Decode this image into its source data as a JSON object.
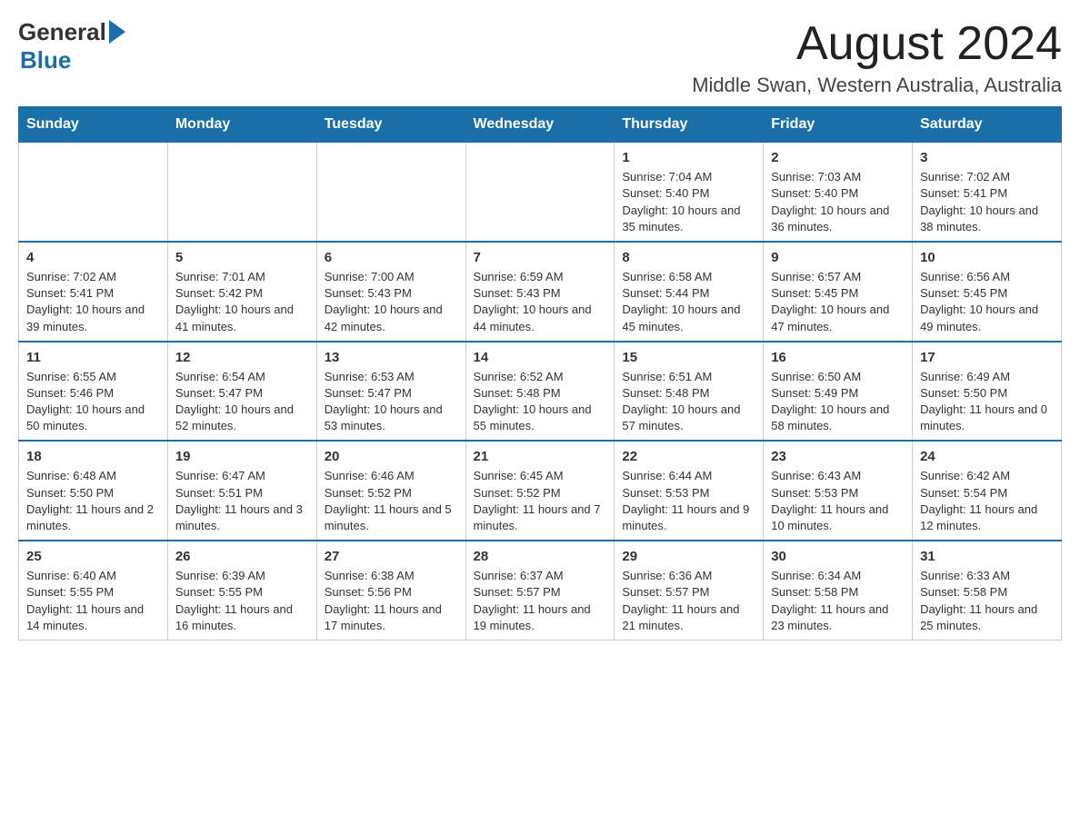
{
  "logo": {
    "general": "General",
    "blue": "Blue"
  },
  "header": {
    "title": "August 2024",
    "subtitle": "Middle Swan, Western Australia, Australia"
  },
  "days": {
    "headers": [
      "Sunday",
      "Monday",
      "Tuesday",
      "Wednesday",
      "Thursday",
      "Friday",
      "Saturday"
    ]
  },
  "weeks": [
    {
      "cells": [
        {
          "day": "",
          "info": ""
        },
        {
          "day": "",
          "info": ""
        },
        {
          "day": "",
          "info": ""
        },
        {
          "day": "",
          "info": ""
        },
        {
          "day": "1",
          "info": "Sunrise: 7:04 AM\nSunset: 5:40 PM\nDaylight: 10 hours and 35 minutes."
        },
        {
          "day": "2",
          "info": "Sunrise: 7:03 AM\nSunset: 5:40 PM\nDaylight: 10 hours and 36 minutes."
        },
        {
          "day": "3",
          "info": "Sunrise: 7:02 AM\nSunset: 5:41 PM\nDaylight: 10 hours and 38 minutes."
        }
      ]
    },
    {
      "cells": [
        {
          "day": "4",
          "info": "Sunrise: 7:02 AM\nSunset: 5:41 PM\nDaylight: 10 hours and 39 minutes."
        },
        {
          "day": "5",
          "info": "Sunrise: 7:01 AM\nSunset: 5:42 PM\nDaylight: 10 hours and 41 minutes."
        },
        {
          "day": "6",
          "info": "Sunrise: 7:00 AM\nSunset: 5:43 PM\nDaylight: 10 hours and 42 minutes."
        },
        {
          "day": "7",
          "info": "Sunrise: 6:59 AM\nSunset: 5:43 PM\nDaylight: 10 hours and 44 minutes."
        },
        {
          "day": "8",
          "info": "Sunrise: 6:58 AM\nSunset: 5:44 PM\nDaylight: 10 hours and 45 minutes."
        },
        {
          "day": "9",
          "info": "Sunrise: 6:57 AM\nSunset: 5:45 PM\nDaylight: 10 hours and 47 minutes."
        },
        {
          "day": "10",
          "info": "Sunrise: 6:56 AM\nSunset: 5:45 PM\nDaylight: 10 hours and 49 minutes."
        }
      ]
    },
    {
      "cells": [
        {
          "day": "11",
          "info": "Sunrise: 6:55 AM\nSunset: 5:46 PM\nDaylight: 10 hours and 50 minutes."
        },
        {
          "day": "12",
          "info": "Sunrise: 6:54 AM\nSunset: 5:47 PM\nDaylight: 10 hours and 52 minutes."
        },
        {
          "day": "13",
          "info": "Sunrise: 6:53 AM\nSunset: 5:47 PM\nDaylight: 10 hours and 53 minutes."
        },
        {
          "day": "14",
          "info": "Sunrise: 6:52 AM\nSunset: 5:48 PM\nDaylight: 10 hours and 55 minutes."
        },
        {
          "day": "15",
          "info": "Sunrise: 6:51 AM\nSunset: 5:48 PM\nDaylight: 10 hours and 57 minutes."
        },
        {
          "day": "16",
          "info": "Sunrise: 6:50 AM\nSunset: 5:49 PM\nDaylight: 10 hours and 58 minutes."
        },
        {
          "day": "17",
          "info": "Sunrise: 6:49 AM\nSunset: 5:50 PM\nDaylight: 11 hours and 0 minutes."
        }
      ]
    },
    {
      "cells": [
        {
          "day": "18",
          "info": "Sunrise: 6:48 AM\nSunset: 5:50 PM\nDaylight: 11 hours and 2 minutes."
        },
        {
          "day": "19",
          "info": "Sunrise: 6:47 AM\nSunset: 5:51 PM\nDaylight: 11 hours and 3 minutes."
        },
        {
          "day": "20",
          "info": "Sunrise: 6:46 AM\nSunset: 5:52 PM\nDaylight: 11 hours and 5 minutes."
        },
        {
          "day": "21",
          "info": "Sunrise: 6:45 AM\nSunset: 5:52 PM\nDaylight: 11 hours and 7 minutes."
        },
        {
          "day": "22",
          "info": "Sunrise: 6:44 AM\nSunset: 5:53 PM\nDaylight: 11 hours and 9 minutes."
        },
        {
          "day": "23",
          "info": "Sunrise: 6:43 AM\nSunset: 5:53 PM\nDaylight: 11 hours and 10 minutes."
        },
        {
          "day": "24",
          "info": "Sunrise: 6:42 AM\nSunset: 5:54 PM\nDaylight: 11 hours and 12 minutes."
        }
      ]
    },
    {
      "cells": [
        {
          "day": "25",
          "info": "Sunrise: 6:40 AM\nSunset: 5:55 PM\nDaylight: 11 hours and 14 minutes."
        },
        {
          "day": "26",
          "info": "Sunrise: 6:39 AM\nSunset: 5:55 PM\nDaylight: 11 hours and 16 minutes."
        },
        {
          "day": "27",
          "info": "Sunrise: 6:38 AM\nSunset: 5:56 PM\nDaylight: 11 hours and 17 minutes."
        },
        {
          "day": "28",
          "info": "Sunrise: 6:37 AM\nSunset: 5:57 PM\nDaylight: 11 hours and 19 minutes."
        },
        {
          "day": "29",
          "info": "Sunrise: 6:36 AM\nSunset: 5:57 PM\nDaylight: 11 hours and 21 minutes."
        },
        {
          "day": "30",
          "info": "Sunrise: 6:34 AM\nSunset: 5:58 PM\nDaylight: 11 hours and 23 minutes."
        },
        {
          "day": "31",
          "info": "Sunrise: 6:33 AM\nSunset: 5:58 PM\nDaylight: 11 hours and 25 minutes."
        }
      ]
    }
  ]
}
